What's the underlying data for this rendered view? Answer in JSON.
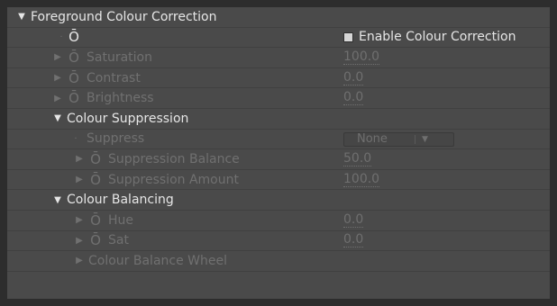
{
  "header": {
    "label": "Foreground Colour Correction"
  },
  "enable": {
    "label": "Enable Colour Correction",
    "checked": false
  },
  "params": {
    "saturation": {
      "label": "Saturation",
      "value": "100.0"
    },
    "contrast": {
      "label": "Contrast",
      "value": "0.0"
    },
    "brightness": {
      "label": "Brightness",
      "value": "0.0"
    }
  },
  "suppression": {
    "label": "Colour Suppression",
    "suppress": {
      "label": "Suppress",
      "value": "None"
    },
    "balance": {
      "label": "Suppression Balance",
      "value": "50.0"
    },
    "amount": {
      "label": "Suppression Amount",
      "value": "100.0"
    }
  },
  "balancing": {
    "label": "Colour Balancing",
    "hue": {
      "label": "Hue",
      "value": "0.0"
    },
    "sat": {
      "label": "Sat",
      "value": "0.0"
    },
    "wheel": {
      "label": "Colour Balance Wheel"
    }
  },
  "icons": {
    "expanded": "triangle-down",
    "collapsed": "triangle-right",
    "stopwatch": "stopwatch-icon",
    "bullet": "dot"
  }
}
